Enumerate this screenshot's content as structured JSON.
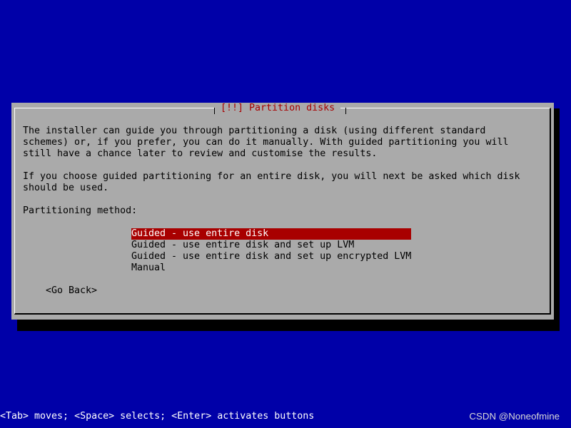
{
  "dialog": {
    "title": "[!!] Partition disks",
    "paragraphs": [
      "The installer can guide you through partitioning a disk (using different standard\nschemes) or, if you prefer, you can do it manually. With guided partitioning you will\nstill have a chance later to review and customise the results.",
      "If you choose guided partitioning for an entire disk, you will next be asked which disk\nshould be used."
    ],
    "method_label": "Partitioning method:",
    "options": [
      {
        "label": "Guided - use entire disk",
        "selected": true
      },
      {
        "label": "Guided - use entire disk and set up LVM",
        "selected": false
      },
      {
        "label": "Guided - use entire disk and set up encrypted LVM",
        "selected": false
      },
      {
        "label": "Manual",
        "selected": false
      }
    ],
    "go_back_label": "<Go Back>"
  },
  "help_bar": {
    "text": "<Tab> moves; <Space> selects; <Enter> activates buttons"
  },
  "watermark": "CSDN @Noneofmine",
  "colors": {
    "background": "#0000a8",
    "dialog": "#aaaaaa",
    "title_text": "#a80000",
    "selection": "#a80000",
    "help_text": "#ffffff"
  }
}
